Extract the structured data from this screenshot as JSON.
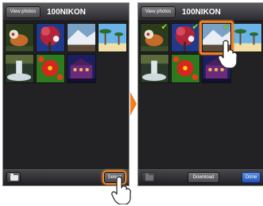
{
  "left_screen": {
    "header": {
      "view_photos_label": "View photos",
      "folder_title": "100NIKON"
    },
    "footer": {
      "select_label": "Select"
    }
  },
  "right_screen": {
    "header": {
      "view_photos_label": "View photos",
      "folder_title": "100NIKON"
    },
    "footer": {
      "download_label": "Download",
      "done_label": "Done"
    },
    "checked_thumbnails": [
      1,
      2,
      3
    ]
  },
  "thumbnails": [
    {
      "name": "mandarin-duck",
      "colors": [
        "#2c3a1e",
        "#c46a2a",
        "#e8e2d2"
      ]
    },
    {
      "name": "red-tree",
      "colors": [
        "#1f3a8a",
        "#b3233a",
        "#f2f2f2"
      ]
    },
    {
      "name": "snowy-landscape",
      "colors": [
        "#7aa1c6",
        "#e8eef4",
        "#5a4a3a"
      ]
    },
    {
      "name": "palm-beach",
      "colors": [
        "#6ab4e8",
        "#f0e0a8",
        "#2e6b2e"
      ]
    },
    {
      "name": "waterfall",
      "colors": [
        "#2a3a2a",
        "#dfe6ea",
        "#5a6a3a"
      ]
    },
    {
      "name": "red-flowers",
      "colors": [
        "#2e7a1e",
        "#d8261c",
        "#f5d21a"
      ]
    },
    {
      "name": "night-building",
      "colors": [
        "#1b1f5e",
        "#f0c060",
        "#6b2a7a"
      ]
    }
  ],
  "colors": {
    "accent": "#f07f22",
    "check": "#7fd62a",
    "done": "#2455b8"
  },
  "icons": {
    "arrow": "arrow-right-icon",
    "hand": "tap-hand-icon",
    "folder": "folder-icon",
    "check": "checkmark-icon"
  }
}
